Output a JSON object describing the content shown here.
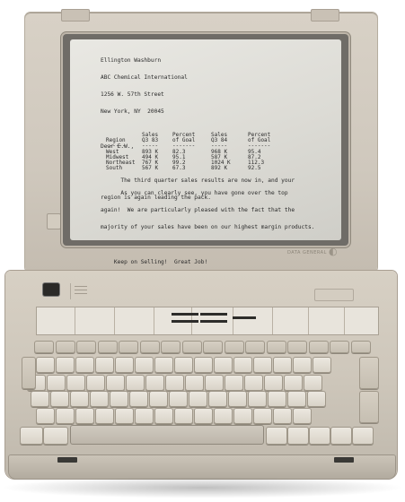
{
  "screen": {
    "address": [
      "Ellington Washburn",
      "ABC Chemical International",
      "1256 W. 57th Street",
      "New York, NY  20045"
    ],
    "greeting": "Dear E.W.,",
    "intro": [
      "      The third quarter sales results are now in, and your",
      "region is again leading the pack."
    ],
    "table": {
      "headers1": [
        "",
        "Sales",
        "Percent",
        "Sales",
        "Percent"
      ],
      "headers2": [
        "Region",
        "Q3 83",
        "of Goal",
        "Q3 84",
        "of Goal"
      ],
      "rows": [
        [
          "West",
          "893 K",
          "82.3",
          "968 K",
          "95.4"
        ],
        [
          "Midwest",
          "494 K",
          "95.1",
          "587 K",
          "87.2"
        ],
        [
          "Northeast",
          "767 K",
          "99.2",
          "1024 K",
          "112.3"
        ],
        [
          "South",
          "567 K",
          "67.3",
          "892 K",
          "92.5"
        ]
      ]
    },
    "closing": [
      "      As you can clearly see, you have gone over the top",
      "again!  We are particularly pleased with the fact that the",
      "majority of your sales have been on our highest margin products."
    ],
    "signoff": "    Keep on Selling!  Great Job!"
  },
  "brand": "DATA GENERAL",
  "colors": {
    "case": "#d7d0c4",
    "screen": "#e3e2dc",
    "bezel": "#6f6c67",
    "text": "#2a2a2a"
  }
}
